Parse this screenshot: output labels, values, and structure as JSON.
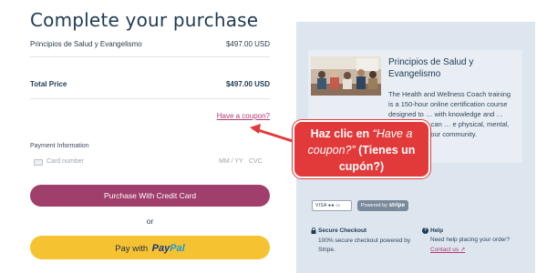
{
  "page": {
    "title": "Complete your purchase"
  },
  "order": {
    "item_name": "Principios de Salud y Evangelismo",
    "item_price": "$497.00 USD",
    "total_label": "Total Price",
    "total_price": "$497.00 USD",
    "coupon_link": "Have a coupon?"
  },
  "payment": {
    "section_label": "Payment Information",
    "card_number_placeholder": "Card number",
    "expiry_placeholder": "MM / YY",
    "cvc_placeholder": "CVC",
    "credit_button": "Purchase With Credit Card",
    "or_text": "or",
    "paypal_prefix": "Pay with",
    "paypal_logo_pay": "Pay",
    "paypal_logo_pal": "Pal"
  },
  "product": {
    "title": "Principios de Salud y Evangelismo",
    "description": "The Health and Wellness Coach training is a 150-hour online certification course designed to … with knowledge and … rience so you can … e physical, mental, and … ds of your community."
  },
  "badges": {
    "cards_text": "VISA ●● ▭",
    "stripe_prefix": "Powered by",
    "stripe_brand": "stripe"
  },
  "footer": {
    "secure_title": "Secure Checkout",
    "secure_text": "100% secure checkout powered by Stripe.",
    "help_title": "Help",
    "help_text": "Need help placing your order?",
    "contact_link": "Contact us"
  },
  "annotation": {
    "prefix": "Haz clic en ",
    "quoted": "“Have a coupon?”",
    "suffix": " (Tienes un cupón?)"
  },
  "colors": {
    "accent": "#a03e6c",
    "paypal_yellow": "#f5c232",
    "panel_bg": "#dde5ee",
    "callout_red": "#e23a3a"
  }
}
